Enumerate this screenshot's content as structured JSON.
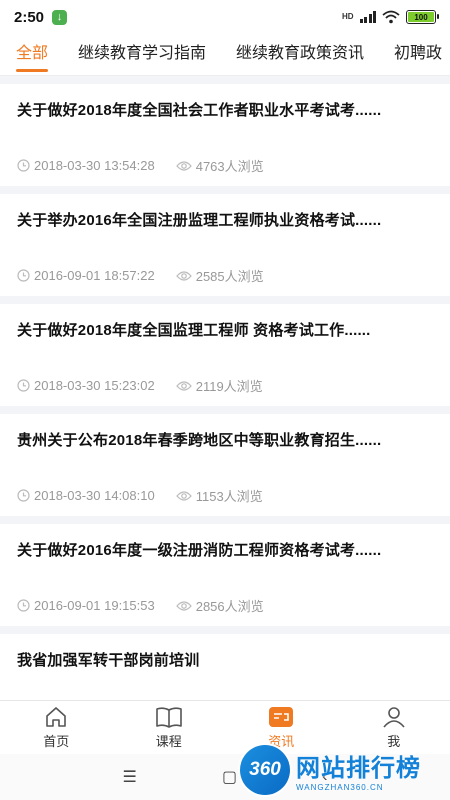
{
  "status_bar": {
    "time": "2:50",
    "network_label": "HD",
    "battery": "100"
  },
  "tabs": [
    {
      "label": "全部"
    },
    {
      "label": "继续教育学习指南"
    },
    {
      "label": "继续教育政策资讯"
    },
    {
      "label": "初聘政"
    }
  ],
  "articles": [
    {
      "title": "关于做好2018年度全国社会工作者职业水平考试考......",
      "datetime": "2018-03-30 13:54:28",
      "views": "4763人浏览"
    },
    {
      "title": "关于举办2016年全国注册监理工程师执业资格考试......",
      "datetime": "2016-09-01 18:57:22",
      "views": "2585人浏览"
    },
    {
      "title": "关于做好2018年度全国监理工程师 资格考试工作......",
      "datetime": "2018-03-30 15:23:02",
      "views": "2119人浏览"
    },
    {
      "title": "贵州关于公布2018年春季跨地区中等职业教育招生......",
      "datetime": "2018-03-30 14:08:10",
      "views": "1153人浏览"
    },
    {
      "title": "关于做好2016年度一级注册消防工程师资格考试考......",
      "datetime": "2016-09-01 19:15:53",
      "views": "2856人浏览"
    },
    {
      "title": "我省加强军转干部岗前培训",
      "datetime": "",
      "views": ""
    }
  ],
  "bottom_nav": {
    "home": "首页",
    "course": "课程",
    "news": "资讯",
    "me": "我"
  },
  "watermark": {
    "badge": "360",
    "name": "网站排行榜",
    "url": "WANGZHAN360.CN"
  },
  "colors": {
    "accent": "#f07a22",
    "meta": "#999999"
  }
}
